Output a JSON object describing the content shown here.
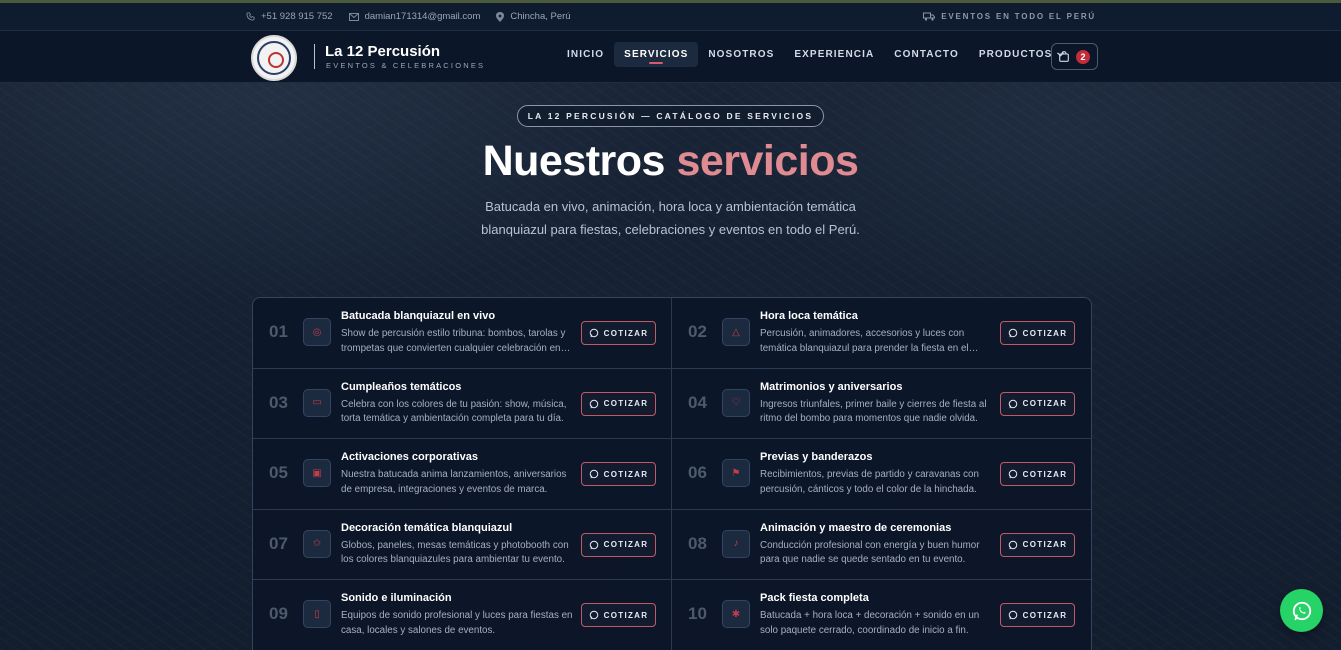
{
  "topbar": {
    "phone": "+51 928 915 752",
    "email": "damian171314@gmail.com",
    "location": "Chincha, Perú",
    "shipping": "EVENTOS EN TODO EL PERÚ"
  },
  "brand": {
    "name": "La 12 Percusión",
    "tagline": "EVENTOS & CELEBRACIONES"
  },
  "nav": {
    "items": [
      "INICIO",
      "SERVICIOS",
      "NOSOTROS",
      "EXPERIENCIA",
      "CONTACTO",
      "PRODUCTOS"
    ],
    "active": "SERVICIOS",
    "cart_count": "2"
  },
  "hero": {
    "eyebrow": "LA 12 PERCUSIÓN — CATÁLOGO DE SERVICIOS",
    "title_main": "Nuestros",
    "title_accent": "servicios",
    "subtitle": "Batucada en vivo, animación, hora loca y ambientación temática blanquiazul para fiestas, celebraciones y eventos en todo el Perú."
  },
  "services": [
    {
      "num": "01",
      "title": "Batucada blanquiazul en vivo",
      "desc": "Show de percusión estilo tribuna: bombos, tarolas y trompetas que convierten cualquier celebración en fiesta.",
      "icon": "drum-icon"
    },
    {
      "num": "02",
      "title": "Hora loca temática",
      "desc": "Percusión, animadores, accesorios y luces con temática blanquiazul para prender la fiesta en el momento clave.",
      "icon": "party-hat-icon"
    },
    {
      "num": "03",
      "title": "Cumpleaños temáticos",
      "desc": "Celebra con los colores de tu pasión: show, música, torta temática y ambientación completa para tu día.",
      "icon": "cake-icon"
    },
    {
      "num": "04",
      "title": "Matrimonios y aniversarios",
      "desc": "Ingresos triunfales, primer baile y cierres de fiesta al ritmo del bombo para momentos que nadie olvida.",
      "icon": "heart-icon"
    },
    {
      "num": "05",
      "title": "Activaciones corporativas",
      "desc": "Nuestra batucada anima lanzamientos, aniversarios de empresa, integraciones y eventos de marca.",
      "icon": "briefcase-icon"
    },
    {
      "num": "06",
      "title": "Previas y banderazos",
      "desc": "Recibimientos, previas de partido y caravanas con percusión, cánticos y todo el color de la hinchada.",
      "icon": "flag-icon"
    },
    {
      "num": "07",
      "title": "Decoración temática blanquiazul",
      "desc": "Globos, paneles, mesas temáticas y photobooth con los colores blanquiazules para ambientar tu evento.",
      "icon": "star-icon"
    },
    {
      "num": "08",
      "title": "Animación y maestro de ceremonias",
      "desc": "Conducción profesional con energía y buen humor para que nadie se quede sentado en tu evento.",
      "icon": "microphone-icon"
    },
    {
      "num": "09",
      "title": "Sonido e iluminación",
      "desc": "Equipos de sonido profesional y luces para fiestas en casa, locales y salones de eventos.",
      "icon": "speaker-icon"
    },
    {
      "num": "10",
      "title": "Pack fiesta completa",
      "desc": "Batucada + hora loca + decoración + sonido en un solo paquete cerrado, coordinado de inicio a fin.",
      "icon": "sparkle-icon"
    }
  ],
  "cta_label": "COTIZAR",
  "colors": {
    "accent": "#e08a92",
    "whatsapp": "#25d366",
    "badge": "#c42c3b"
  }
}
